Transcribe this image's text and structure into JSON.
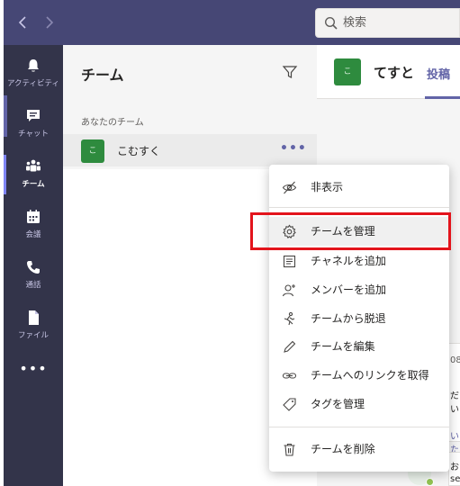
{
  "titlebar": {
    "back_icon": "chevron-left-icon",
    "forward_icon": "chevron-right-icon",
    "search_placeholder": "検索"
  },
  "rail": {
    "items": [
      {
        "label": "アクティビティ",
        "icon": "bell-icon"
      },
      {
        "label": "チャット",
        "icon": "chat-icon"
      },
      {
        "label": "チーム",
        "icon": "teams-icon",
        "active": true
      },
      {
        "label": "会議",
        "icon": "calendar-icon"
      },
      {
        "label": "通話",
        "icon": "phone-icon"
      },
      {
        "label": "ファイル",
        "icon": "file-icon"
      }
    ],
    "more_label": "•••"
  },
  "panel": {
    "title": "チーム",
    "section_label": "あなたのチーム",
    "teams": [
      {
        "avatar_text": "こ",
        "name": "こむすく",
        "more_label": "•••"
      }
    ]
  },
  "main": {
    "avatar_text": "こ",
    "title": "てすと",
    "tab_label": "投稿",
    "partial_texts": [
      "08",
      "だい",
      "いた",
      "お",
      "se"
    ]
  },
  "menu": {
    "items": [
      {
        "label": "非表示",
        "icon": "eye-hidden-icon"
      },
      {
        "label": "チームを管理",
        "icon": "gear-icon"
      },
      {
        "label": "チャネルを追加",
        "icon": "add-channel-icon"
      },
      {
        "label": "メンバーを追加",
        "icon": "add-member-icon"
      },
      {
        "label": "チームから脱退",
        "icon": "leave-icon"
      },
      {
        "label": "チームを編集",
        "icon": "pencil-icon"
      },
      {
        "label": "チームへのリンクを取得",
        "icon": "link-icon"
      },
      {
        "label": "タグを管理",
        "icon": "tag-icon"
      },
      {
        "label": "チームを削除",
        "icon": "trash-icon"
      }
    ]
  },
  "colors": {
    "titlebar": "#464775",
    "rail": "#33344a",
    "accent": "#6264a7",
    "team_avatar": "#2e8b3e",
    "highlight": "#e3141c"
  }
}
